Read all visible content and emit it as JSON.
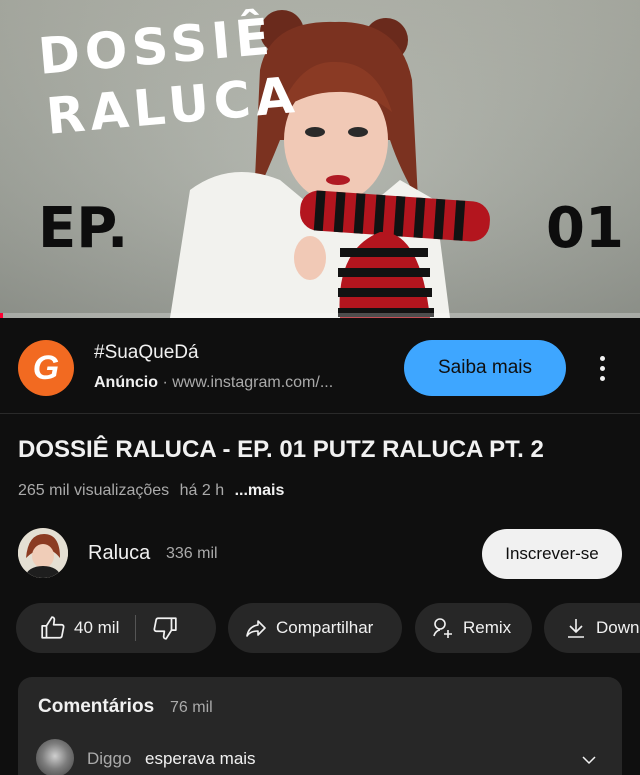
{
  "player": {
    "overlay_line1": "DOSSIÊ",
    "overlay_line2": "RALUCA",
    "ep_label": "EP.",
    "ep_number": "01",
    "progress_fraction": 0.005,
    "progress_color": "#ff0033"
  },
  "ad": {
    "logo_letter": "G",
    "title": "#SuaQueDá",
    "badge": "Anúncio",
    "separator": "·",
    "url": "www.instagram.com/...",
    "cta": "Saiba mais",
    "logo_color": "#f26a21",
    "cta_color": "#3ea6ff"
  },
  "video": {
    "title": "DOSSIÊ RALUCA - EP. 01 PUTZ RALUCA PT. 2",
    "views": "265 mil visualizações",
    "age": "há 2 h",
    "more": "...mais"
  },
  "channel": {
    "name": "Raluca",
    "subscribers": "336 mil",
    "subscribe_label": "Inscrever-se"
  },
  "actions": {
    "likes": "40 mil",
    "share": "Compartilhar",
    "remix": "Remix",
    "download": "Download"
  },
  "comments": {
    "heading": "Comentários",
    "count": "76 mil",
    "top_comment": {
      "user": "Diggo",
      "text": "esperava mais"
    }
  }
}
